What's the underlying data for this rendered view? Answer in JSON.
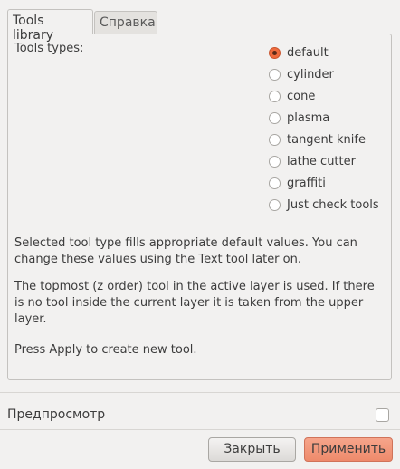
{
  "tabs": [
    {
      "label": "Tools library",
      "active": true
    },
    {
      "label": "Справка",
      "active": false
    }
  ],
  "tools_type_label": "Tools types:",
  "options": [
    "default",
    "cylinder",
    "cone",
    "plasma",
    "tangent knife",
    "lathe cutter",
    "graffiti",
    "Just check tools"
  ],
  "selected": "default",
  "paragraphs": [
    "Selected tool type fills appropriate default values. You can change these values using the Text tool later on.",
    "The topmost (z order) tool in the active layer is used. If there is no tool inside the current layer it is taken from the upper layer.",
    "Press Apply to create new tool."
  ],
  "preview": {
    "label": "Предпросмотр",
    "checked": false
  },
  "buttons": {
    "close": "Закрыть",
    "apply": "Применить"
  },
  "colors": {
    "accent": "#ee6b3d",
    "apply_bg": "#f0957a"
  }
}
